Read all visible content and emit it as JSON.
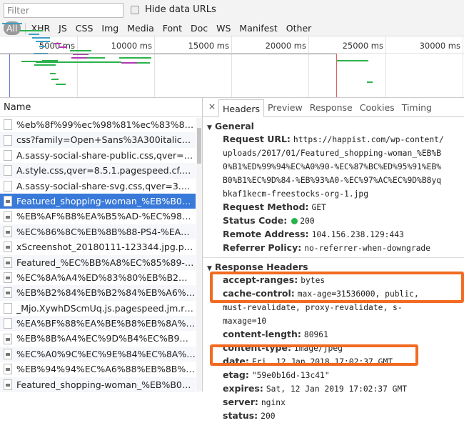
{
  "toolbar": {
    "filter_placeholder": "Filter",
    "hide_data_urls": "Hide data URLs",
    "types": [
      "All",
      "XHR",
      "JS",
      "CSS",
      "Img",
      "Media",
      "Font",
      "Doc",
      "WS",
      "Manifest",
      "Other"
    ]
  },
  "timeline": {
    "ticks": [
      "5000 ms",
      "10000 ms",
      "15000 ms",
      "20000 ms",
      "25000 ms",
      "30000 ms"
    ]
  },
  "requests": {
    "header": "Name",
    "selected_index": 5,
    "items": [
      {
        "name": "%eb%8f%99%ec%98%81%ec%83%81%ec%...",
        "type": "doc"
      },
      {
        "name": "css?family=Open+Sans%3A300italic%2C400...",
        "type": "doc"
      },
      {
        "name": "A.sassy-social-share-public.css,qver=3.1.6.pa...",
        "type": "doc"
      },
      {
        "name": "A.style.css,qver=8.5.1.pagespeed.cf.wisgplZd...",
        "type": "doc"
      },
      {
        "name": "A.sassy-social-share-svg.css,qver=3.1.6.page...",
        "type": "doc"
      },
      {
        "name": "Featured_shopping-woman_%EB%B0%B1%E...",
        "type": "img"
      },
      {
        "name": "%EB%AF%B8%EA%B5%AD-%EC%98%81%E...",
        "type": "img"
      },
      {
        "name": "%EC%86%8C%EB%8B%88-PS4-%EA%B4%9...",
        "type": "img"
      },
      {
        "name": "xScreenshot_20180111-123344.jpg.pagespe...",
        "type": "img"
      },
      {
        "name": "Featured_%EC%BB%A8%EC%85%89-%EC%...",
        "type": "img"
      },
      {
        "name": "%EC%8A%A4%ED%83%80%EB%B2%85%EC...",
        "type": "img"
      },
      {
        "name": "%EB%B2%84%EB%B2%84%EB%A6%AC-%EB...",
        "type": "img"
      },
      {
        "name": "_Mjo.XywhDScmUq.js.pagespeed.jm.rOw9d...",
        "type": "doc"
      },
      {
        "name": "%EA%BF%88%EA%BE%B8%EB%8A%94%EC...",
        "type": "doc"
      },
      {
        "name": "%EB%8B%A4%EC%9D%B4%EC%B9%B8%EC...",
        "type": "img"
      },
      {
        "name": "%EC%A0%9C%EC%9E%84%EC%8A%A4-%E...",
        "type": "img"
      },
      {
        "name": "%EB%94%94%EC%A6%88%EB%8B%88-%ED...",
        "type": "img"
      },
      {
        "name": "Featured_shopping-woman_%EB%B0%B1%E...",
        "type": "img"
      }
    ]
  },
  "detail": {
    "close": "×",
    "tabs": [
      "Headers",
      "Preview",
      "Response",
      "Cookies",
      "Timing"
    ],
    "active_tab": "Headers",
    "general": {
      "title": "General",
      "request_url": {
        "k": "Request URL:",
        "v": "https://happist.com/wp-content/uploads/2017/01/Featured_shopping-woman_%EB%B0%B1%ED%99%94%EC%A0%90-%EC%87%BC%ED%95%91%EB%B0%B1%EC%9D%84-%EB%93%A0-%EC%97%AC%EC%9D%B8yqbkaf1kecm-freestocks-org-1.jpg"
      },
      "request_method": {
        "k": "Request Method:",
        "v": "GET"
      },
      "status_code": {
        "k": "Status Code:",
        "v": "200",
        "status_color": "#2bb24c"
      },
      "remote_address": {
        "k": "Remote Address:",
        "v": "104.156.238.129:443"
      },
      "referrer_policy": {
        "k": "Referrer Policy:",
        "v": "no-referrer-when-downgrade"
      }
    },
    "response": {
      "title": "Response Headers",
      "highlight_color": "#f26b22",
      "headers": [
        {
          "k": "accept-ranges:",
          "v": "bytes"
        },
        {
          "k": "cache-control:",
          "v": "max-age=31536000, public, must-revalidate, proxy-revalidate, s-maxage=10",
          "highlighted": true
        },
        {
          "k": "content-length:",
          "v": "80961"
        },
        {
          "k": "content-type:",
          "v": "image/jpeg"
        },
        {
          "k": "date:",
          "v": "Fri, 12 Jan 2018 17:02:37 GMT"
        },
        {
          "k": "etag:",
          "v": "\"59e0b16d-13c41\""
        },
        {
          "k": "expires:",
          "v": "Sat, 12 Jan 2019 17:02:37 GMT",
          "highlighted": true
        },
        {
          "k": "server:",
          "v": "nginx"
        },
        {
          "k": "status:",
          "v": "200"
        }
      ]
    }
  }
}
